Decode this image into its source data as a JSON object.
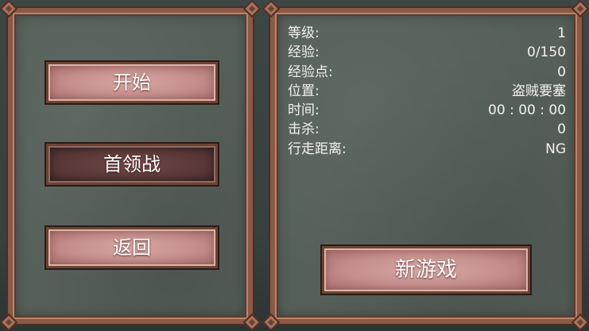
{
  "left_menu": {
    "buttons": [
      {
        "label": "开始",
        "selected": false
      },
      {
        "label": "首领战",
        "selected": true
      },
      {
        "label": "返回",
        "selected": false
      }
    ]
  },
  "stats": [
    {
      "label": "等级:",
      "value": "1"
    },
    {
      "label": "经验:",
      "value": "0/150"
    },
    {
      "label": "经验点:",
      "value": "0"
    },
    {
      "label": "位置:",
      "value": "盗贼要塞"
    },
    {
      "label": "时间:",
      "value": "00 : 00 : 00"
    },
    {
      "label": "击杀:",
      "value": "0"
    },
    {
      "label": "行走距离:",
      "value": "NG"
    }
  ],
  "new_game_label": "新游戏",
  "colors": {
    "panel_bg": "#56605a",
    "frame": "#8a5a46",
    "button": "#c48e8b",
    "button_selected": "#5a3838",
    "text": "#ffffff"
  }
}
